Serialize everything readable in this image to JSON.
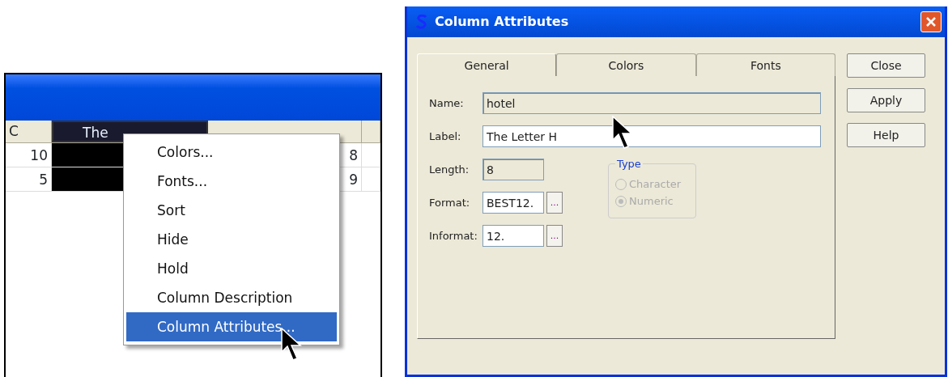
{
  "table": {
    "columns": [
      {
        "label": "C",
        "selected": false
      },
      {
        "label": "The",
        "selected": true
      },
      {
        "selected": false
      }
    ],
    "rows": [
      {
        "column_1": "10",
        "column_3": "8"
      },
      {
        "column_1": "5",
        "column_3": "9"
      }
    ]
  },
  "context_menu": {
    "items": [
      {
        "label": "Colors...",
        "selected": false
      },
      {
        "label": "Fonts...",
        "selected": false
      },
      {
        "label": "Sort",
        "selected": false
      },
      {
        "label": "Hide",
        "selected": false
      },
      {
        "label": "Hold",
        "selected": false
      },
      {
        "label": "Column Description",
        "selected": false
      },
      {
        "label": "Column Attributes...",
        "selected": true
      }
    ]
  },
  "dialog": {
    "title": "Column Attributes",
    "tabs": [
      {
        "label": "General",
        "selected": true
      },
      {
        "label": "Colors",
        "selected": false
      },
      {
        "label": "Fonts",
        "selected": false
      }
    ],
    "fields": [
      {
        "label": "Name:",
        "value": "hotel",
        "disabled": true,
        "kind": "wide"
      },
      {
        "label": "Label:",
        "value": "The Letter H",
        "disabled": false,
        "kind": "wide"
      },
      {
        "label": "Length:",
        "value": "8",
        "disabled": true,
        "kind": "short"
      },
      {
        "label": "Format:",
        "value": "BEST12.",
        "disabled": false,
        "kind": "browse",
        "browse": "..."
      },
      {
        "label": "Informat:",
        "value": "12.",
        "disabled": false,
        "kind": "browse",
        "browse": "..."
      }
    ],
    "type_group": {
      "title": "Type",
      "options": [
        {
          "label": "Character",
          "selected": false,
          "disabled": true
        },
        {
          "label": "Numeric",
          "selected": true,
          "disabled": true
        }
      ]
    },
    "buttons": [
      "Close",
      "Apply",
      "Help"
    ]
  }
}
